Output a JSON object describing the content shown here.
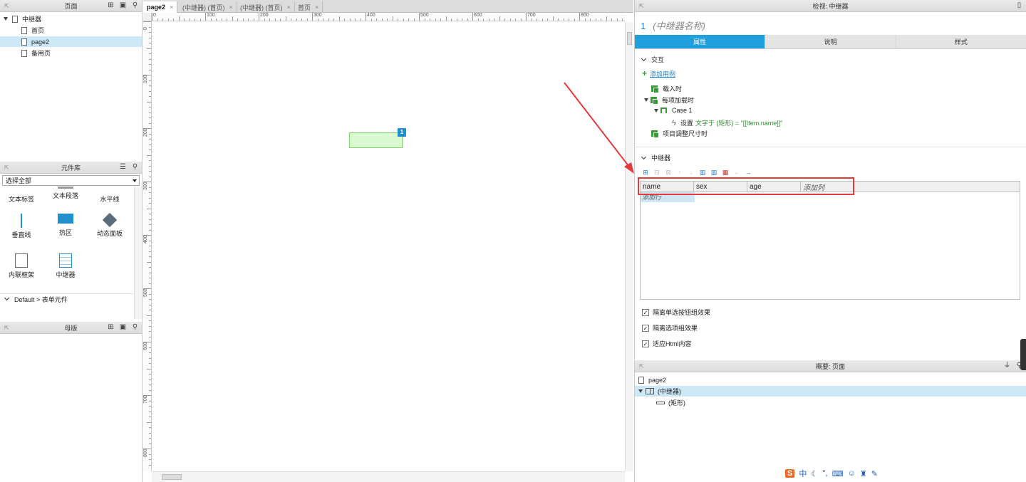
{
  "pages_panel": {
    "title": "页面",
    "tree": [
      {
        "label": "中继器",
        "level": 0,
        "selected": false
      },
      {
        "label": "首页",
        "level": 1,
        "selected": false
      },
      {
        "label": "page2",
        "level": 1,
        "selected": true
      },
      {
        "label": "备用页",
        "level": 1,
        "selected": false
      }
    ]
  },
  "library_panel": {
    "title": "元件库",
    "filter": "选择全部",
    "widgets": [
      "文本标签",
      "文本段落",
      "水平线",
      "垂直线",
      "热区",
      "动态面板",
      "内联框架",
      "中继器"
    ],
    "group_label": "Default > 表单元件"
  },
  "masters_panel": {
    "title": "母版"
  },
  "tabs": [
    {
      "label": "page2",
      "active": true
    },
    {
      "label": "(中继器) (首页)",
      "active": false
    },
    {
      "label": "(中继器) (首页)",
      "active": false
    },
    {
      "label": "首页",
      "active": false
    }
  ],
  "ruler_h": [
    "0",
    "100",
    "200",
    "300",
    "400",
    "500",
    "600",
    "700",
    "800"
  ],
  "ruler_v": [
    "0",
    "100",
    "200",
    "300",
    "400",
    "500",
    "600",
    "700",
    "800"
  ],
  "canvas": {
    "badge": "1"
  },
  "inspector": {
    "header": "检视: 中继器",
    "index": "1",
    "name_placeholder": "(中继器名称)",
    "tabs": [
      "属性",
      "说明",
      "样式"
    ],
    "interaction_title": "交互",
    "add_case": "添加用例",
    "events": [
      {
        "label": "载入时"
      },
      {
        "label": "每项加载时"
      },
      {
        "label": "Case 1"
      },
      {
        "label": "设置",
        "detail": "文字于 (矩形) = \"[[Item.name]]\""
      },
      {
        "label": "项目调整尺寸时"
      }
    ],
    "repeater_title": "中继器",
    "columns": [
      "name",
      "sex",
      "age",
      "添加列"
    ],
    "add_row": "添加行",
    "checkboxes": [
      {
        "label": "隔离单选按钮组效果",
        "checked": true
      },
      {
        "label": "隔离选项组效果",
        "checked": true
      },
      {
        "label": "适应Html内容",
        "checked": true
      }
    ]
  },
  "outline": {
    "header": "概要: 页面",
    "items": [
      {
        "label": "page2",
        "selected": false
      },
      {
        "label": "(中继器)",
        "selected": true
      },
      {
        "label": "(矩形)",
        "selected": false
      }
    ]
  },
  "ime_bar": [
    "S",
    "中"
  ]
}
